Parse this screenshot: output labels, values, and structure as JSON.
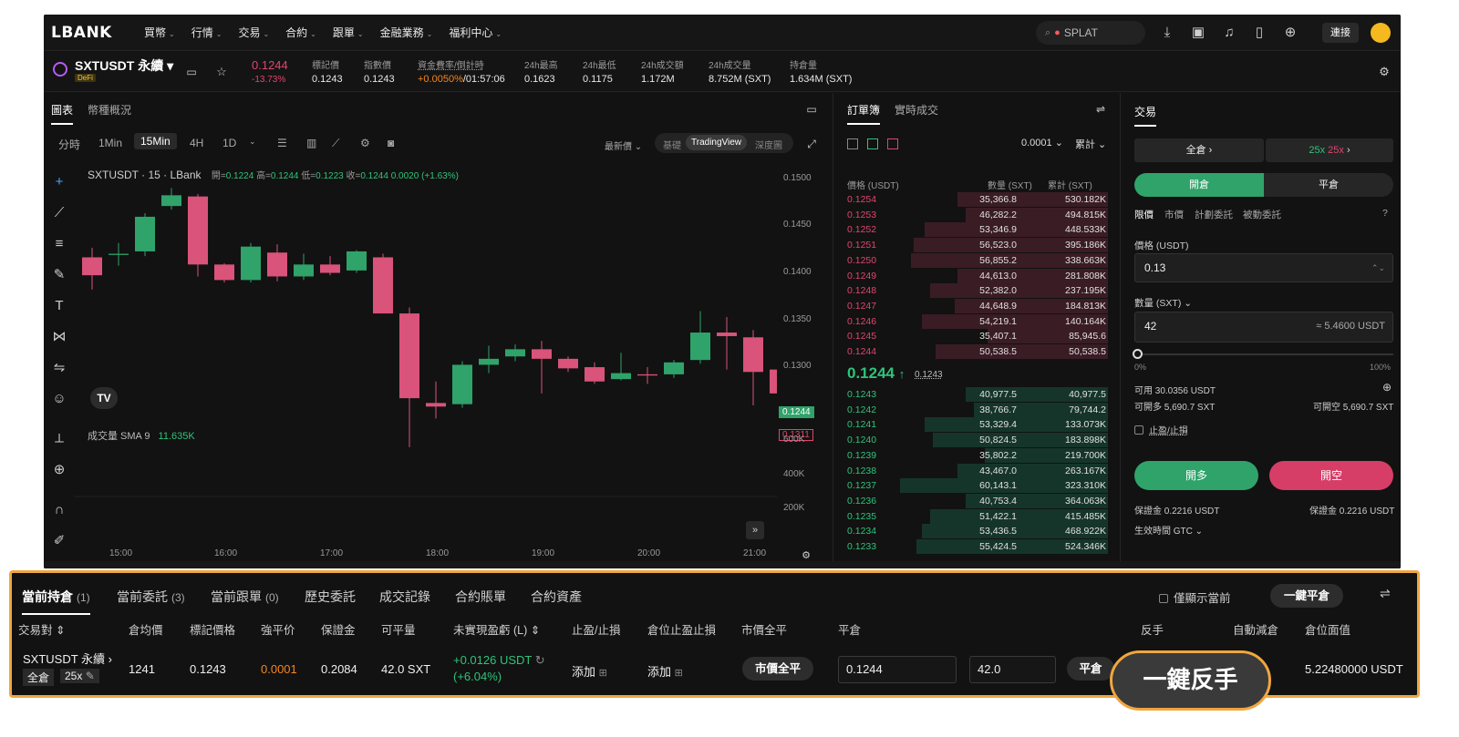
{
  "nav": {
    "logo": "LBANK",
    "items": [
      "買幣",
      "行情",
      "交易",
      "合約",
      "跟單",
      "金融業務",
      "福利中心"
    ],
    "search_placeholder": "SPLAT",
    "login": "連接"
  },
  "ticker": {
    "symbol": "SXTUSDT 永續",
    "tag": "DeFi",
    "price": "0.1244",
    "change": "-13.73%",
    "stats": [
      {
        "label": "標記價",
        "value": "0.1243"
      },
      {
        "label": "指數價",
        "value": "0.1243"
      },
      {
        "label": "資金費率/倒計時",
        "value": "+0.0050%",
        "value2": "/01:57:06"
      },
      {
        "label": "24h最高",
        "value": "0.1623"
      },
      {
        "label": "24h最低",
        "value": "0.1175"
      },
      {
        "label": "24h成交額",
        "value": "1.172M"
      },
      {
        "label": "24h成交量",
        "value": "8.752M (SXT)"
      },
      {
        "label": "持倉量",
        "value": "1.634M (SXT)"
      }
    ]
  },
  "chart_panel": {
    "tabs": [
      "圖表",
      "幣種概況"
    ],
    "timeframes": [
      "分時",
      "1Min",
      "15Min",
      "4H",
      "1D"
    ],
    "selected_tf": "15Min",
    "price_type": "最新價",
    "modes": [
      "基礎",
      "TradingView",
      "深度圖"
    ],
    "info_title": "SXTUSDT · 15 · LBank",
    "info_ohlc_open_label": "開=",
    "info_open": "0.1224",
    "info_high_label": "高=",
    "info_high": "0.1244",
    "info_low_label": "低=",
    "info_low": "0.1223",
    "info_close_label": "收=",
    "info_close": "0.1244",
    "info_change": "0.0020 (+1.63%)",
    "volume_label": "成交量 SMA 9",
    "volume_value": "11.635K",
    "last_price_tag": "0.1244",
    "red_price_tag": "0.1311",
    "tv_logo": "TV"
  },
  "chart_data": {
    "type": "candlestick",
    "y_ticks": [
      "0.1500",
      "0.1450",
      "0.1400",
      "0.1350",
      "0.1300"
    ],
    "volume_ticks": [
      "600K",
      "400K",
      "200K"
    ],
    "x_ticks": [
      "15:00",
      "16:00",
      "17:00",
      "18:00",
      "19:00",
      "20:00",
      "21:00"
    ],
    "ylim": [
      0.1244,
      0.1505
    ],
    "candles": [
      {
        "o": 0.1439,
        "c": 0.1424,
        "h": 0.1447,
        "l": 0.1412
      },
      {
        "o": 0.1441,
        "c": 0.1442,
        "h": 0.1451,
        "l": 0.1432
      },
      {
        "o": 0.1444,
        "c": 0.1473,
        "h": 0.1476,
        "l": 0.144
      },
      {
        "o": 0.1482,
        "c": 0.1491,
        "h": 0.1497,
        "l": 0.1479
      },
      {
        "o": 0.149,
        "c": 0.1433,
        "h": 0.1492,
        "l": 0.1423
      },
      {
        "o": 0.1433,
        "c": 0.142,
        "h": 0.1434,
        "l": 0.1418
      },
      {
        "o": 0.142,
        "c": 0.1448,
        "h": 0.1451,
        "l": 0.1418
      },
      {
        "o": 0.1443,
        "c": 0.1423,
        "h": 0.145,
        "l": 0.1419
      },
      {
        "o": 0.1423,
        "c": 0.1433,
        "h": 0.1442,
        "l": 0.142
      },
      {
        "o": 0.1433,
        "c": 0.1426,
        "h": 0.144,
        "l": 0.1424
      },
      {
        "o": 0.1428,
        "c": 0.1444,
        "h": 0.1445,
        "l": 0.1426
      },
      {
        "o": 0.1439,
        "c": 0.1392,
        "h": 0.1442,
        "l": 0.1392
      },
      {
        "o": 0.1392,
        "c": 0.1321,
        "h": 0.1397,
        "l": 0.128
      },
      {
        "o": 0.1317,
        "c": 0.1314,
        "h": 0.1335,
        "l": 0.1304
      },
      {
        "o": 0.1316,
        "c": 0.1349,
        "h": 0.1352,
        "l": 0.1313
      },
      {
        "o": 0.1349,
        "c": 0.1354,
        "h": 0.1365,
        "l": 0.1342
      },
      {
        "o": 0.1356,
        "c": 0.1362,
        "h": 0.1366,
        "l": 0.1352
      },
      {
        "o": 0.1362,
        "c": 0.1354,
        "h": 0.1369,
        "l": 0.1325
      },
      {
        "o": 0.1354,
        "c": 0.1346,
        "h": 0.1356,
        "l": 0.1343
      },
      {
        "o": 0.1347,
        "c": 0.1335,
        "h": 0.1351,
        "l": 0.1333
      },
      {
        "o": 0.1337,
        "c": 0.1342,
        "h": 0.1359,
        "l": 0.1336
      },
      {
        "o": 0.1341,
        "c": 0.134,
        "h": 0.1347,
        "l": 0.1333
      },
      {
        "o": 0.1341,
        "c": 0.1351,
        "h": 0.1353,
        "l": 0.1338
      },
      {
        "o": 0.1353,
        "c": 0.1376,
        "h": 0.1394,
        "l": 0.135
      },
      {
        "o": 0.1376,
        "c": 0.1373,
        "h": 0.1389,
        "l": 0.1345
      },
      {
        "o": 0.1372,
        "c": 0.1343,
        "h": 0.1378,
        "l": 0.1315
      },
      {
        "o": 0.1345,
        "c": 0.1325,
        "h": 0.1346,
        "l": 0.132
      }
    ],
    "volume": [
      90,
      130,
      120,
      140,
      170,
      150,
      210,
      160,
      190,
      140,
      150,
      180,
      240,
      200,
      230,
      170,
      150,
      160,
      180,
      210,
      190,
      220,
      150,
      200,
      330,
      230,
      210
    ]
  },
  "orderbook": {
    "tabs": [
      "訂單簿",
      "實時成交"
    ],
    "precision": "0.0001",
    "mode": "累計",
    "headers": [
      "價格 (USDT)",
      "數量 (SXT)",
      "累計 (SXT)"
    ],
    "asks": [
      {
        "p": "0.1254",
        "q": "35,366.8",
        "c": "530.182K",
        "d": 0.55
      },
      {
        "p": "0.1253",
        "q": "46,282.2",
        "c": "494.815K",
        "d": 0.52
      },
      {
        "p": "0.1252",
        "q": "53,346.9",
        "c": "448.533K",
        "d": 0.67
      },
      {
        "p": "0.1251",
        "q": "56,523.0",
        "c": "395.186K",
        "d": 0.71
      },
      {
        "p": "0.1250",
        "q": "56,855.2",
        "c": "338.663K",
        "d": 0.72
      },
      {
        "p": "0.1249",
        "q": "44,613.0",
        "c": "281.808K",
        "d": 0.55
      },
      {
        "p": "0.1248",
        "q": "52,382.0",
        "c": "237.195K",
        "d": 0.65
      },
      {
        "p": "0.1247",
        "q": "44,648.9",
        "c": "184.813K",
        "d": 0.56
      },
      {
        "p": "0.1246",
        "q": "54,219.1",
        "c": "140.164K",
        "d": 0.68
      },
      {
        "p": "0.1245",
        "q": "35,407.1",
        "c": "85,945.6",
        "d": 0.44
      },
      {
        "p": "0.1244",
        "q": "50,538.5",
        "c": "50,538.5",
        "d": 0.63
      }
    ],
    "mid_price": "0.1244",
    "mid_arrow": "↑",
    "mid_ref": "0.1243",
    "bids": [
      {
        "p": "0.1243",
        "q": "40,977.5",
        "c": "40,977.5",
        "d": 0.52
      },
      {
        "p": "0.1242",
        "q": "38,766.7",
        "c": "79,744.2",
        "d": 0.49
      },
      {
        "p": "0.1241",
        "q": "53,329.4",
        "c": "133.073K",
        "d": 0.67
      },
      {
        "p": "0.1240",
        "q": "50,824.5",
        "c": "183.898K",
        "d": 0.64
      },
      {
        "p": "0.1239",
        "q": "35,802.2",
        "c": "219.700K",
        "d": 0.45
      },
      {
        "p": "0.1238",
        "q": "43,467.0",
        "c": "263.167K",
        "d": 0.55
      },
      {
        "p": "0.1237",
        "q": "60,143.1",
        "c": "323.310K",
        "d": 0.76
      },
      {
        "p": "0.1236",
        "q": "40,753.4",
        "c": "364.063K",
        "d": 0.52
      },
      {
        "p": "0.1235",
        "q": "51,422.1",
        "c": "415.485K",
        "d": 0.65
      },
      {
        "p": "0.1234",
        "q": "53,436.5",
        "c": "468.922K",
        "d": 0.68
      },
      {
        "p": "0.1233",
        "q": "55,424.5",
        "c": "524.346K",
        "d": 0.7
      }
    ]
  },
  "trade": {
    "title": "交易",
    "margin_mode": "全倉",
    "leverage1": "25x",
    "leverage2": "25x",
    "open_tab": "開倉",
    "close_tab": "平倉",
    "order_types": [
      "限價",
      "市價",
      "計劃委託",
      "被動委託"
    ],
    "price_label": "價格 (USDT)",
    "price_value": "0.13",
    "qty_label": "數量 (SXT)",
    "qty_value": "42",
    "qty_approx": "≈ 5.4600 USDT",
    "slider_min": "0%",
    "slider_max": "100%",
    "available": "可用 30.0356 USDT",
    "can_long": "可開多 5,690.7 SXT",
    "can_short": "可開空 5,690.7 SXT",
    "tpsl": "止盈/止損",
    "long_btn": "開多",
    "short_btn": "開空",
    "margin_left": "保證金 0.2216 USDT",
    "margin_right": "保證金 0.2216 USDT",
    "tif": "生效時間 GTC"
  },
  "positions": {
    "tabs": [
      {
        "label": "當前持倉",
        "count": "(1)"
      },
      {
        "label": "當前委託",
        "count": "(3)"
      },
      {
        "label": "當前跟單",
        "count": "(0)"
      },
      {
        "label": "歷史委託",
        "count": ""
      },
      {
        "label": "成交記錄",
        "count": ""
      },
      {
        "label": "合約賬單",
        "count": ""
      },
      {
        "label": "合約資產",
        "count": ""
      }
    ],
    "show_current": "僅顯示當前",
    "close_all": "一鍵平倉",
    "columns": [
      "交易對 ⇕",
      "倉均價",
      "標記價格",
      "強平价",
      "保證金",
      "可平量",
      "未實現盈虧 (L) ⇕",
      "止盈/止損",
      "倉位止盈止損",
      "市價全平",
      "平倉",
      "反手",
      "自動減倉",
      "倉位面值"
    ],
    "row": {
      "pair": "SXTUSDT 永續",
      "margin_mode": "全倉",
      "leverage": "25x",
      "avg_price": "1241",
      "mark_price": "0.1243",
      "liq_price": "0.0001",
      "margin": "0.2084",
      "closable": "42.0 SXT",
      "pnl": "+0.0126 USDT",
      "pnl_pct": "(+6.04%)",
      "tpsl_add": "添加",
      "pos_tpsl_add": "添加",
      "market_close": "市價全平",
      "close_price": "0.1244",
      "close_qty": "42.0",
      "close_btn": "平倉",
      "notional": "5.22480000 USDT"
    }
  },
  "callout": "一鍵反手"
}
